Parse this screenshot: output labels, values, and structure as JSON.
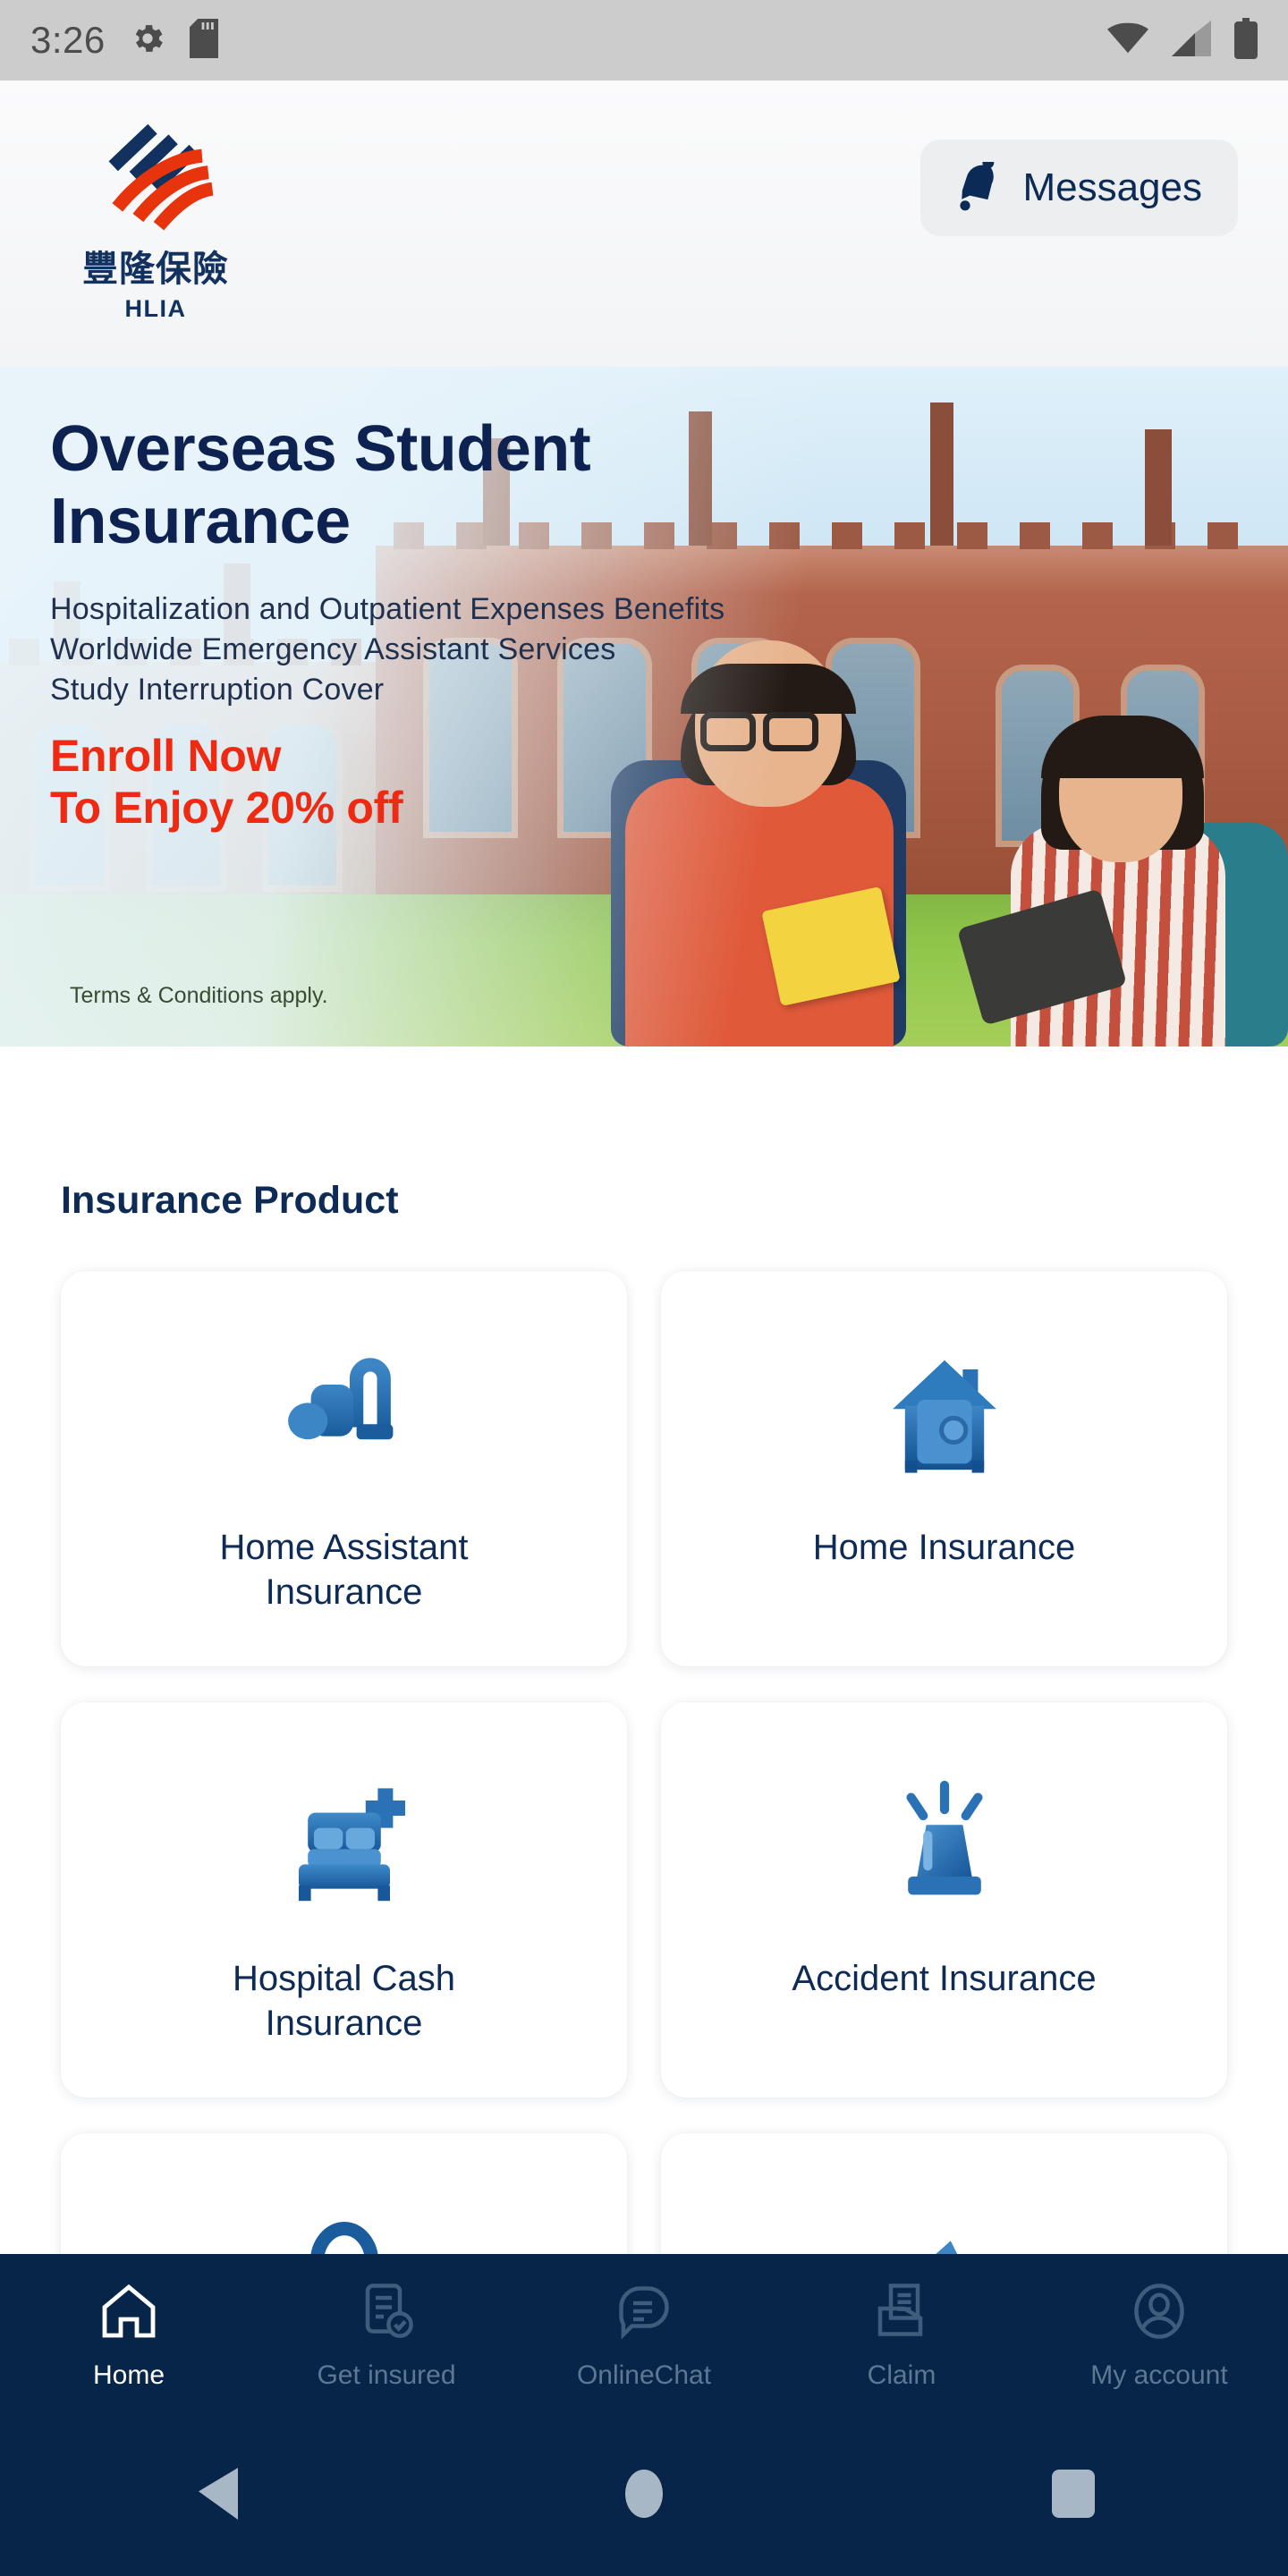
{
  "status_bar": {
    "time": "3:26",
    "icons_left": [
      "gear-icon",
      "sd-card-icon"
    ],
    "icons_right": [
      "wifi-icon",
      "cellular-signal-icon",
      "battery-icon"
    ],
    "background_color": "#cccccc"
  },
  "header": {
    "logo": {
      "chinese_name": "豐隆保險",
      "english_abbr": "HLIA",
      "navy_color": "#12315e",
      "red_color": "#e8340c"
    },
    "messages_button": {
      "label": "Messages",
      "icon": "bell-icon",
      "background_color": "#eceef0",
      "text_color": "#0b2a55"
    }
  },
  "banner": {
    "title_line1": "Overseas Student",
    "title_line2": "Insurance",
    "title_color": "#0d2250",
    "bullets": [
      "Hospitalization and Outpatient Expenses Benefits",
      "Worldwide Emergency Assistant Services",
      "Study Interruption Cover"
    ],
    "cta_line1": "Enroll Now",
    "cta_line2": "To Enjoy 20% off",
    "cta_color": "#ee2a12",
    "terms": "Terms & Conditions apply."
  },
  "products": {
    "section_title": "Insurance Product",
    "section_title_color": "#0d2b55",
    "items": [
      {
        "label_line1": "Home Assistant",
        "label_line2": "Insurance",
        "icon": "vacuum-cleaner-icon"
      },
      {
        "label_line1": "Home Insurance",
        "label_line2": "",
        "icon": "house-safe-icon"
      },
      {
        "label_line1": "Hospital Cash",
        "label_line2": "Insurance",
        "icon": "hospital-bed-icon"
      },
      {
        "label_line1": "Accident Insurance",
        "label_line2": "",
        "icon": "siren-light-icon"
      },
      {
        "label_line1": "",
        "label_line2": "",
        "icon": "ring-icon"
      },
      {
        "label_line1": "",
        "label_line2": "",
        "icon": "shape-icon"
      }
    ],
    "icon_color": "#2a72b5",
    "card_background": "#ffffff"
  },
  "bottom_nav": {
    "background_color": "#062548",
    "active_color": "#ffffff",
    "inactive_color": "#5d7894",
    "items": [
      {
        "label": "Home",
        "icon": "home-icon",
        "active": true
      },
      {
        "label": "Get insured",
        "icon": "document-check-icon",
        "active": false
      },
      {
        "label": "OnlineChat",
        "icon": "chat-bubble-icon",
        "active": false
      },
      {
        "label": "Claim",
        "icon": "claim-folder-icon",
        "active": false
      },
      {
        "label": "My account",
        "icon": "user-avatar-icon",
        "active": false
      }
    ]
  },
  "android_nav": {
    "background_color": "#062548",
    "buttons": [
      {
        "name": "back-button",
        "icon": "triangle-back-icon"
      },
      {
        "name": "home-button",
        "icon": "circle-home-icon"
      },
      {
        "name": "recents-button",
        "icon": "square-recents-icon"
      }
    ]
  }
}
